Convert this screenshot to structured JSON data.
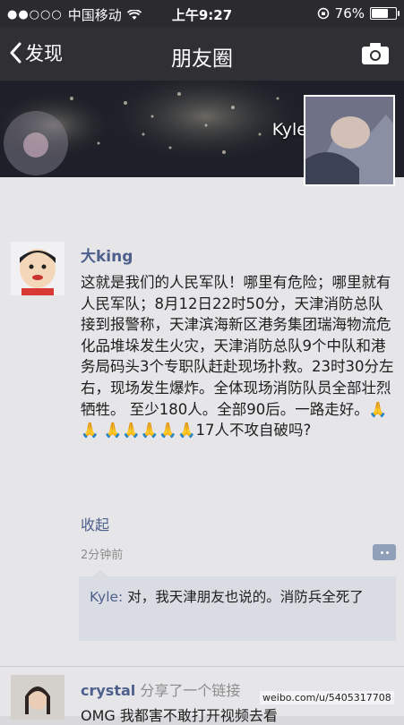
{
  "status_bar": {
    "carrier": "中国移动",
    "time": "上午9:27",
    "battery": "76%",
    "battery_level": 0.76
  },
  "nav": {
    "back_label": "发现",
    "title": "朋友圈"
  },
  "cover": {
    "username": "Kyle"
  },
  "post": {
    "author": "大king",
    "text": "这就是我们的人民军队！哪里有危险；哪里就有人民军队；8月12日22时50分，天津消防总队接到报警称，天津滨海新区港务集团瑞海物流危化品堆垛发生火灾，天津消防总队9个中队和港务局码头3个专职队赶赴现场扑救。23时30分左右，现场发生爆炸。全体现场消防队员全部壮烈牺牲。 至少180人。全部90后。一路走好。🙏🙏 🙏🙏🙏🙏🙏17人不攻自破吗?",
    "collapse_label": "收起",
    "time_ago": "2分钟前",
    "comment": {
      "author": "Kyle:",
      "text": " 对，我天津朋友也说的。消防兵全死了"
    }
  },
  "post2": {
    "author": "crystal",
    "action": " 分享了一个链接",
    "text_partial": "OMG 我都害不敢打开视频去看"
  },
  "watermark": "weibo.com/u/5405317708"
}
